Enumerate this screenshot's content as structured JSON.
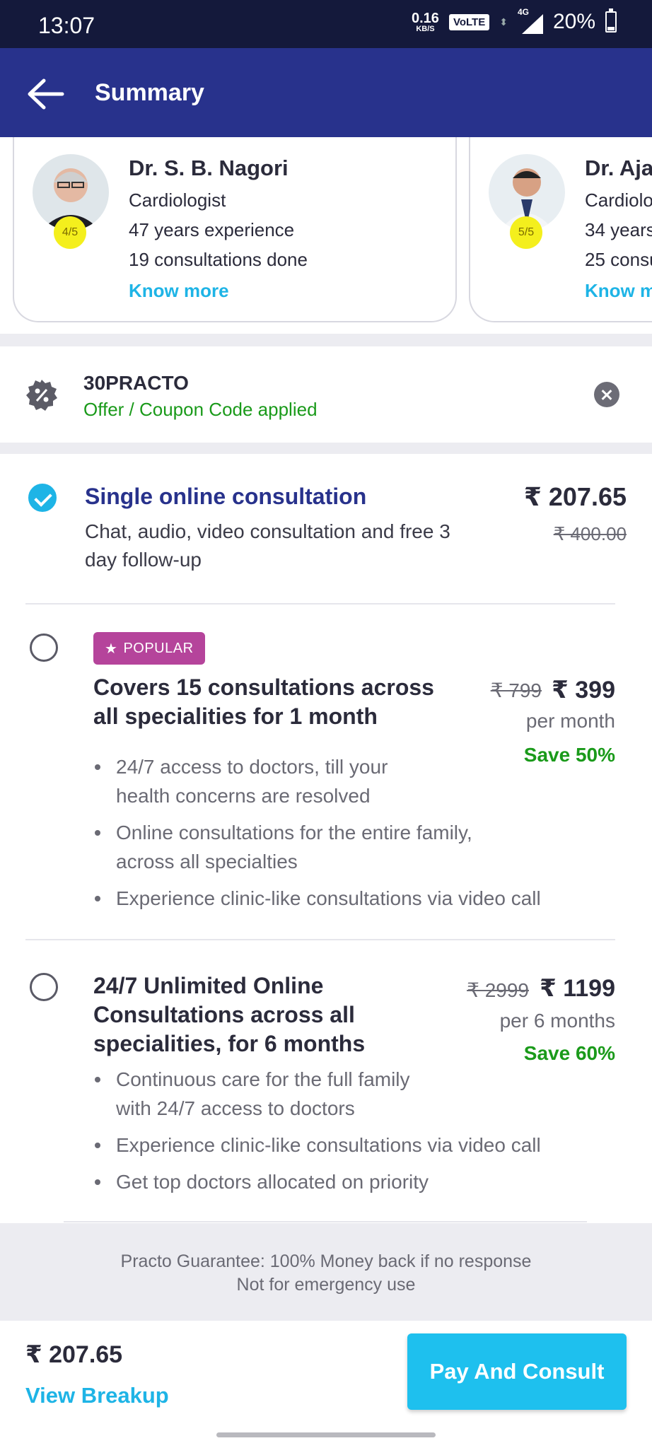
{
  "status_bar": {
    "time": "13:07",
    "net_speed": "0.16",
    "net_unit": "KB/S",
    "volte": "VoLTE",
    "network": "4G",
    "battery": "20%"
  },
  "header": {
    "title": "Summary"
  },
  "doctors": [
    {
      "name": "Dr. S. B. Nagori",
      "specialty": "Cardiologist",
      "experience_num": "47",
      "experience_text": " years experience",
      "consult_num": "19",
      "consult_text": " consultations done",
      "rating": "4/5",
      "link": "Know more"
    },
    {
      "name": "Dr. Aja",
      "specialty": "Cardiolo",
      "experience_num": "34",
      "experience_text": " years",
      "consult_num": "25",
      "consult_text": " consu",
      "rating": "5/5",
      "link": "Know m"
    }
  ],
  "coupon": {
    "code": "30PRACTO",
    "status": "Offer / Coupon Code applied"
  },
  "plans": [
    {
      "title": "Single online consultation",
      "desc": "Chat, audio, video consultation and free 3 day follow-up",
      "price": "₹ 207.65",
      "old_price": "₹ 400.00"
    },
    {
      "badge": "POPULAR",
      "title": "Covers 15 consultations across all specialities for 1 month",
      "old_price": "₹ 799",
      "price": "₹ 399",
      "period": "per month",
      "save": "Save 50%",
      "bullets": [
        "24/7 access to doctors, till your health concerns are resolved",
        "Online consultations for the entire family, across all specialties",
        "Experience clinic-like consultations via video call"
      ]
    },
    {
      "title": "24/7 Unlimited Online Consultations across all specialities, for 6 months",
      "old_price": "₹ 2999",
      "price": "₹ 1199",
      "period": "per 6 months",
      "save": "Save 60%",
      "bullets": [
        "Continuous care for the full family with 24/7 access to doctors",
        "Experience clinic-like consultations via video call",
        "Get top doctors allocated on priority"
      ]
    }
  ],
  "guarantee": {
    "line1": "Practo Guarantee: 100% Money back if no response",
    "line2": "Not for emergency use"
  },
  "footer": {
    "total": "₹ 207.65",
    "breakup_link": "View Breakup",
    "pay_button": "Pay And Consult"
  },
  "colors": {
    "header_bg": "#28328c",
    "accent": "#1eb4e6",
    "popular_badge": "#b5449b",
    "save_green": "#1a9a1a"
  }
}
